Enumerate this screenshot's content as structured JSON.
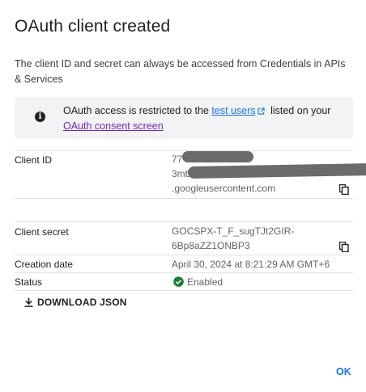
{
  "dialog": {
    "title": "OAuth client created",
    "intro": "The client ID and secret can always be accessed from Credentials in APIs & Services",
    "notice": {
      "text_before": "OAuth access is restricted to the ",
      "link1": "test users",
      "text_middle": " listed on your ",
      "link2": "OAuth consent screen"
    },
    "client_id": {
      "label": "Client ID",
      "line1": "77",
      "line2": "3mb",
      "line3": ".googleusercontent.com"
    },
    "client_secret": {
      "label": "Client secret",
      "line1": "GOCSPX-T_F_sugTJt2GIR-",
      "line2": "6Bp8aZZ1ONBP3"
    },
    "creation_date": {
      "label": "Creation date",
      "value": "April 30, 2024 at 8:21:29 AM GMT+6"
    },
    "status": {
      "label": "Status",
      "value": "Enabled"
    },
    "download_label": "DOWNLOAD JSON",
    "ok_label": "OK"
  },
  "colors": {
    "link": "#1a73e8",
    "visited_link": "#7627bb",
    "enabled": "#188038",
    "notice_bg": "#f1f3f4"
  },
  "icons": [
    "info-icon",
    "external-link-icon",
    "copy-icon",
    "check-circle-icon",
    "download-icon"
  ]
}
